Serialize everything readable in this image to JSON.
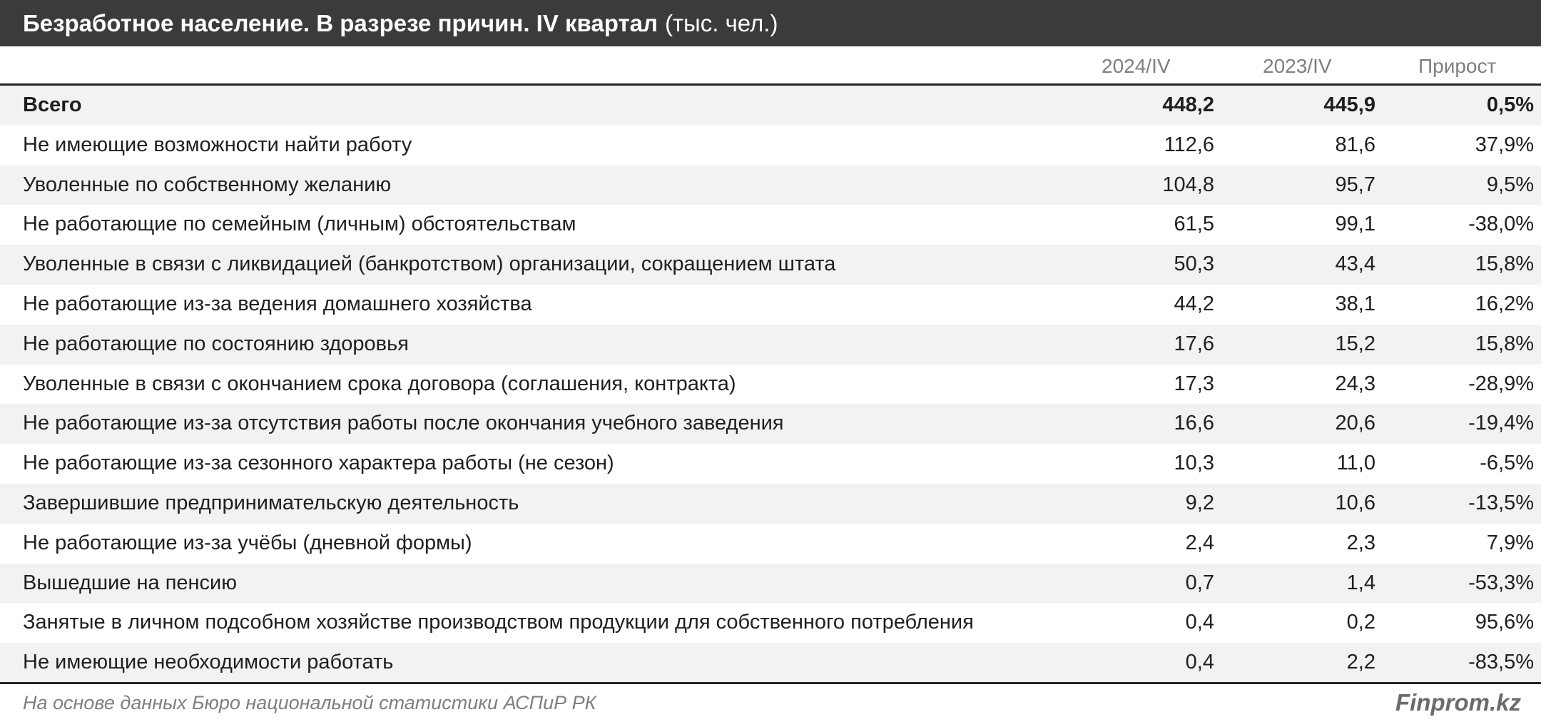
{
  "title": {
    "main": "Безработное население. В разрезе причин. IV квартал",
    "unit": "(тыс. чел.)"
  },
  "columns": [
    "2024/IV",
    "2023/IV",
    "Прирост"
  ],
  "footer": {
    "source": "На основе данных Бюро национальной статистики АСПиР РК",
    "brand": "Finprom.kz"
  },
  "chart_data": {
    "type": "table",
    "title": "Безработное население. В разрезе причин. IV квартал (тыс. чел.)",
    "columns": [
      "2024/IV",
      "2023/IV",
      "Прирост"
    ],
    "rows": [
      {
        "label": "Всего",
        "v2024": "448,2",
        "v2023": "445,9",
        "growth": "0,5%"
      },
      {
        "label": "Не имеющие возможности найти работу",
        "v2024": "112,6",
        "v2023": "81,6",
        "growth": "37,9%"
      },
      {
        "label": "Уволенные по собственному желанию",
        "v2024": "104,8",
        "v2023": "95,7",
        "growth": "9,5%"
      },
      {
        "label": "Не работающие по семейным (личным) обстоятельствам",
        "v2024": "61,5",
        "v2023": "99,1",
        "growth": "-38,0%"
      },
      {
        "label": "Уволенные в связи с ликвидацией (банкротством) организации, сокращением штата",
        "v2024": "50,3",
        "v2023": "43,4",
        "growth": "15,8%"
      },
      {
        "label": "Не работающие из-за ведения домашнего хозяйства",
        "v2024": "44,2",
        "v2023": "38,1",
        "growth": "16,2%"
      },
      {
        "label": "Не работающие по состоянию здоровья",
        "v2024": "17,6",
        "v2023": "15,2",
        "growth": "15,8%"
      },
      {
        "label": "Уволенные в связи с окончанием срока договора (соглашения, контракта)",
        "v2024": "17,3",
        "v2023": "24,3",
        "growth": "-28,9%"
      },
      {
        "label": "Не работающие из-за отсутствия работы после окончания учебного заведения",
        "v2024": "16,6",
        "v2023": "20,6",
        "growth": "-19,4%"
      },
      {
        "label": "Не работающие из-за сезонного характера работы (не сезон)",
        "v2024": "10,3",
        "v2023": "11,0",
        "growth": "-6,5%"
      },
      {
        "label": "Завершившие предпринимательскую деятельность",
        "v2024": "9,2",
        "v2023": "10,6",
        "growth": "-13,5%"
      },
      {
        "label": "Не работающие из-за учёбы (дневной формы)",
        "v2024": "2,4",
        "v2023": "2,3",
        "growth": "7,9%"
      },
      {
        "label": "Вышедшие на пенсию",
        "v2024": "0,7",
        "v2023": "1,4",
        "growth": "-53,3%"
      },
      {
        "label": "Занятые в личном подсобном хозяйстве производством продукции для собственного потребления",
        "v2024": "0,4",
        "v2023": "0,2",
        "growth": "95,6%"
      },
      {
        "label": "Не имеющие необходимости работать",
        "v2024": "0,4",
        "v2023": "2,2",
        "growth": "-83,5%"
      }
    ]
  }
}
